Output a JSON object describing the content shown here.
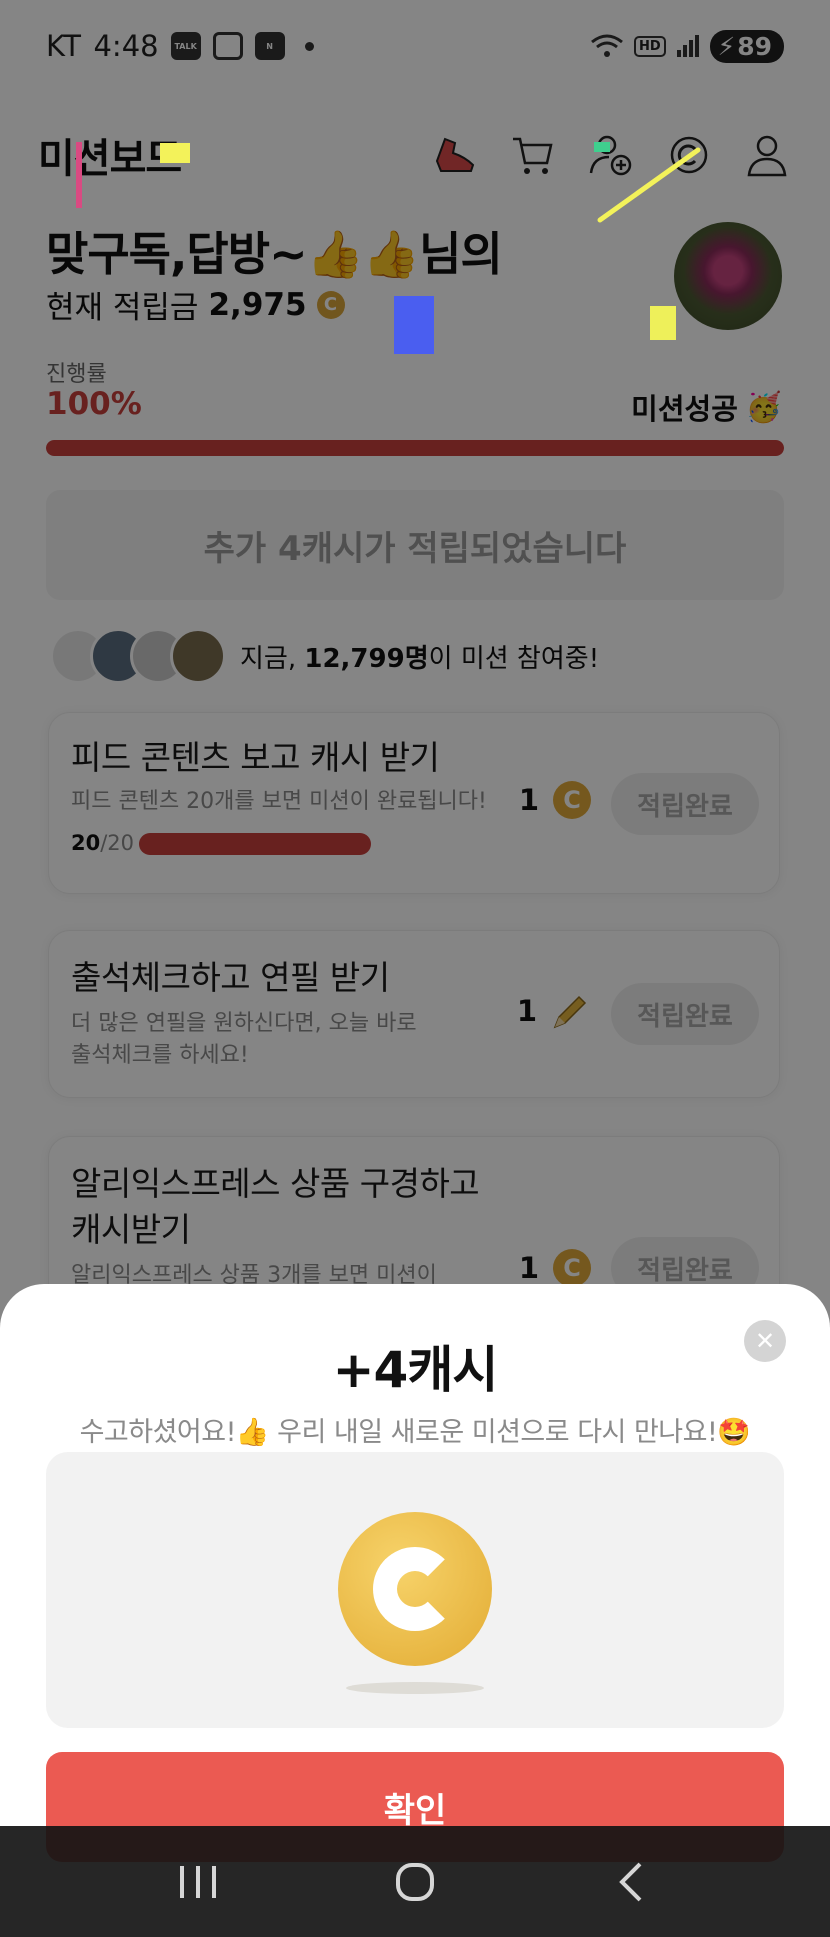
{
  "status_bar": {
    "carrier": "KT",
    "time": "4:48",
    "talk_icon_label": "TALK",
    "mail_icon_label": "N",
    "hd_label": "HD",
    "battery": "89"
  },
  "header": {
    "title": "미션보드",
    "icons": [
      "shoe-icon",
      "cart-icon",
      "add-friend-icon",
      "coin-history-icon",
      "profile-icon"
    ]
  },
  "profile": {
    "greeting": "맞구독,답방~👍👍님의",
    "balance_label": "현재 적립금",
    "balance_amount": "2,975",
    "coin_symbol": "C"
  },
  "progress": {
    "label": "진행률",
    "percent_text": "100%",
    "value": 1.0,
    "success_text": "미션성공",
    "success_emoji": "🥳",
    "accent_color": "#c8403c"
  },
  "reward_banner": {
    "text": "추가 4캐시가 적립되었습니다"
  },
  "participants": {
    "prefix": "지금,",
    "count": "12,799명",
    "suffix": "이 미션 참여중!"
  },
  "missions": [
    {
      "title": "피드 콘텐츠 보고 캐시 받기",
      "description": "피드 콘텐츠 20개를 보면 미션이 완료됩니다!",
      "count_done": "20",
      "count_total": "/20",
      "progress": 1.0,
      "reward_amount": "1",
      "reward_icon": "coin-icon",
      "button_label": "적립완료"
    },
    {
      "title": "출석체크하고 연필 받기",
      "description_line1": "더 많은 연필을 원하신다면, 오늘 바로",
      "description_line2": "출석체크를 하세요!",
      "reward_amount": "1",
      "reward_icon": "pencil-icon",
      "button_label": "적립완료"
    },
    {
      "title_line1": "알리익스프레스 상품 구경하고",
      "title_line2": "캐시받기",
      "description": "알리익스프레스 상품 3개를 보면 미션이",
      "reward_amount": "1",
      "reward_icon": "coin-icon",
      "button_label": "적립완료"
    }
  ],
  "sheet": {
    "title": "+4캐시",
    "message": "수고하셨어요!👍 우리 내일 새로운 미션으로 다시 만나요!🤩",
    "close_symbol": "✕",
    "confirm_label": "확인",
    "confirm_color": "#eb5a52"
  },
  "nav": {
    "recents_symbol": "|||",
    "home_icon": "home-icon",
    "back_icon": "back-icon"
  }
}
